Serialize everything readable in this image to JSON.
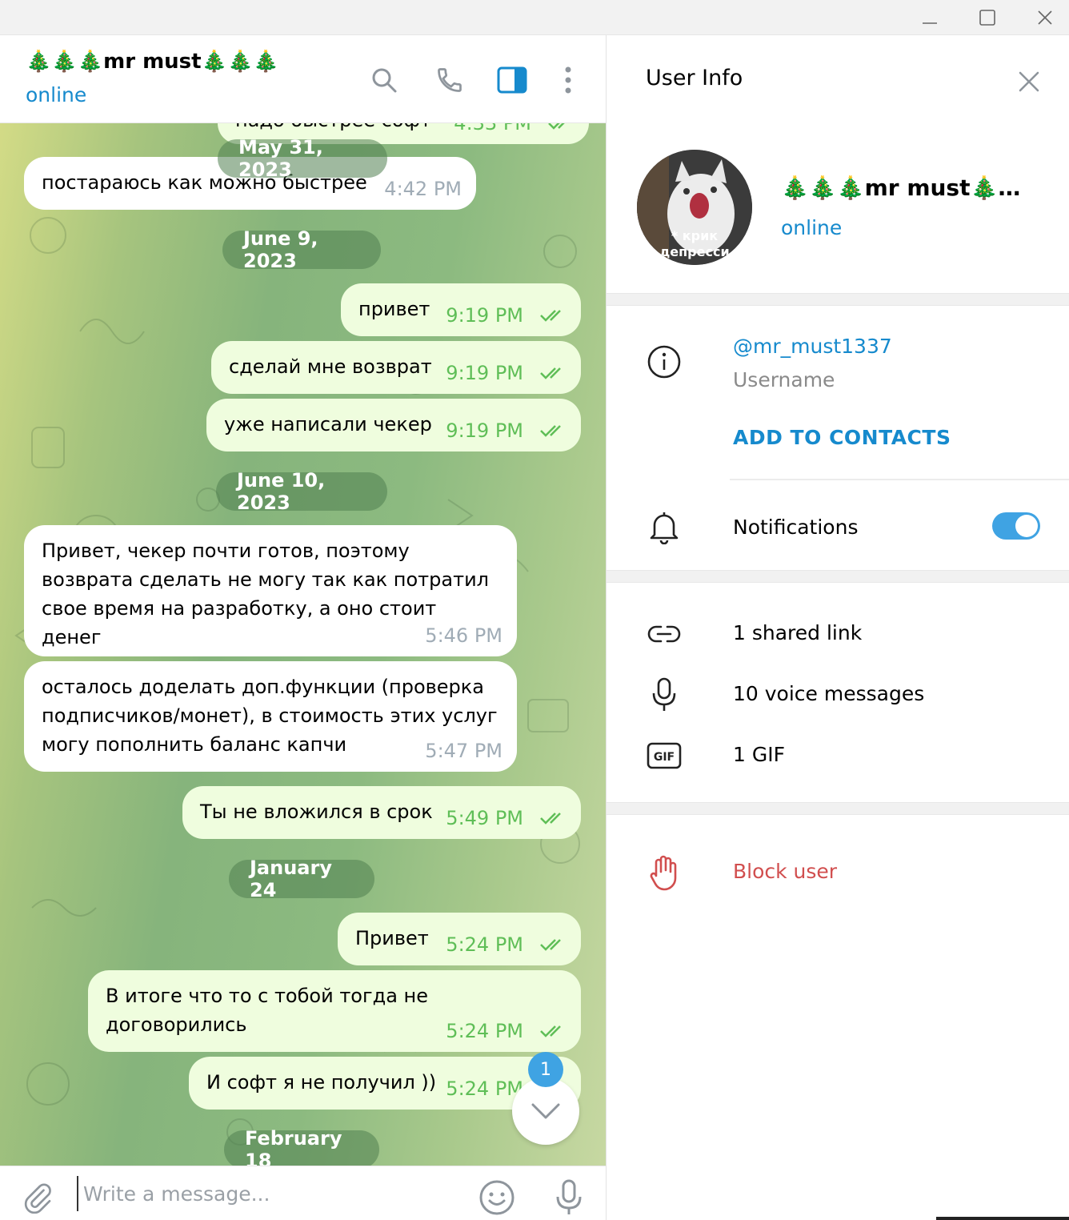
{
  "window": {
    "controls": [
      "minimize-icon",
      "maximize-icon",
      "close-icon"
    ]
  },
  "chat": {
    "title": "🎄🎄🎄mr must🎄🎄🎄",
    "status": "online",
    "header_icons": [
      "search-icon",
      "phone-icon",
      "sidebar-toggle-icon",
      "more-icon"
    ],
    "partial_top_time": "4:33 PM",
    "partial_top_text": "надо быстрее софт",
    "dates": {
      "d1": "May 31, 2023",
      "d2": "June 9, 2023",
      "d3": "June 10, 2023",
      "d4": "January 24",
      "d5": "February 18"
    },
    "messages": [
      {
        "dir": "in",
        "text": "постараюсь как можно быстрее",
        "time": "4:42 PM"
      },
      {
        "dir": "out",
        "text": "привет",
        "time": "9:19 PM"
      },
      {
        "dir": "out",
        "text": "сделай мне возврат",
        "time": "9:19 PM"
      },
      {
        "dir": "out",
        "text": "уже написали чекер",
        "time": "9:19 PM"
      },
      {
        "dir": "in",
        "text": "Привет, чекер почти готов, поэтому\nвозврата сделать не могу так как потратил\nсвое время на разработку, а оно стоит денег",
        "time": "5:46 PM"
      },
      {
        "dir": "in",
        "text": "осталось доделать доп.функции (проверка\nподписчиков/монет), в стоимость этих услуг\nмогу пополнить баланс капчи",
        "time": "5:47 PM"
      },
      {
        "dir": "out",
        "text": "Ты не вложился в срок",
        "time": "5:49 PM"
      },
      {
        "dir": "out",
        "text": "Привет",
        "time": "5:24 PM"
      },
      {
        "dir": "out",
        "text": "В итоге что то с тобой тогда не\nдоговорились",
        "time": "5:24 PM"
      },
      {
        "dir": "out",
        "text": "И софт я не получил ))",
        "time": "5:24 PM"
      }
    ],
    "unread_count": "1",
    "composer_placeholder": "Write a message..."
  },
  "user_info": {
    "title": "User Info",
    "name": "🎄🎄🎄mr must🎄…",
    "status": "online",
    "avatar_caption": "* крик\nдепресси",
    "username": "@mr_must1337",
    "username_label": "Username",
    "add_contacts": "ADD TO CONTACTS",
    "notifications_label": "Notifications",
    "notifications_on": true,
    "shared_links": "1 shared link",
    "voice_messages": "10 voice messages",
    "gifs": "1 GIF",
    "block_user": "Block user"
  },
  "colors": {
    "accent": "#168acd",
    "outgoing_bubble": "#effdde",
    "outgoing_meta": "#5fbe57",
    "danger": "#d14e4e",
    "toggle": "#3fa3e3"
  }
}
